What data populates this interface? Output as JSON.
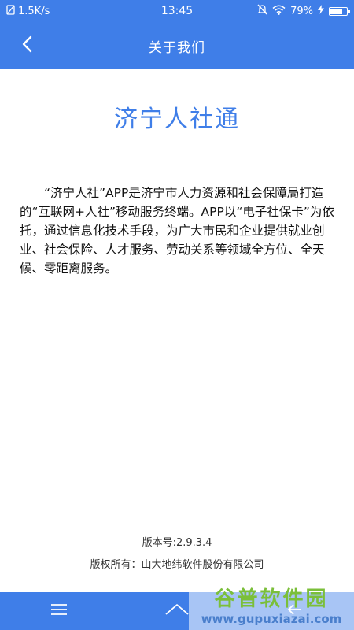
{
  "status_bar": {
    "network_speed": "1.5K/s",
    "time": "13:45",
    "battery_percent": "79%",
    "battery_level": 0.79,
    "icons": [
      "sim-off-icon",
      "mute-icon",
      "wifi-icon",
      "charging-icon",
      "battery-icon"
    ]
  },
  "header": {
    "title": "关于我们",
    "back_icon": "chevron-left-icon"
  },
  "content": {
    "app_name": "济宁人社通",
    "intro": "“济宁人社”APP是济宁市人力资源和社会保障局打造的“互联网+人社”移动服务终端。APP以“电子社保卡”为依托，通过信息化技术手段，为广大市民和企业提供就业创业、社会保险、人才服务、劳动关系等领域全方位、全天候、零距离服务。",
    "version": "版本号:2.9.3.4",
    "copyright": "版权所有：山大地纬软件股份有限公司"
  },
  "nav_bar": {
    "icons": [
      "menu-icon",
      "home-icon",
      "back-icon"
    ]
  },
  "watermark": {
    "title": "谷普软件园",
    "url": "www.gupuxiazai.com"
  },
  "colors": {
    "primary": "#3f7ee8",
    "text": "#111111",
    "watermark_green": "#7bbf3a"
  }
}
